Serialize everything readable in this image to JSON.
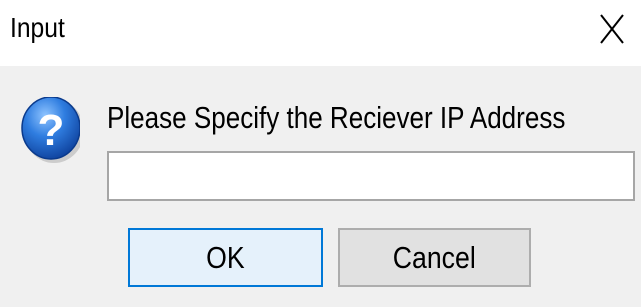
{
  "window": {
    "title": "Input",
    "close_icon": "close-x-icon"
  },
  "dialog": {
    "icon": "question-icon",
    "message": "Please Specify the Reciever IP Address",
    "input": {
      "value": "",
      "placeholder": ""
    },
    "buttons": {
      "ok_label": "OK",
      "cancel_label": "Cancel"
    }
  },
  "colors": {
    "titlebar_bg": "#ffffff",
    "content_bg": "#f0f0f0",
    "ok_border": "#0078d7",
    "ok_bg": "#e5f1fb",
    "cancel_bg": "#e1e1e1",
    "icon_blue": "#1b64c8"
  }
}
